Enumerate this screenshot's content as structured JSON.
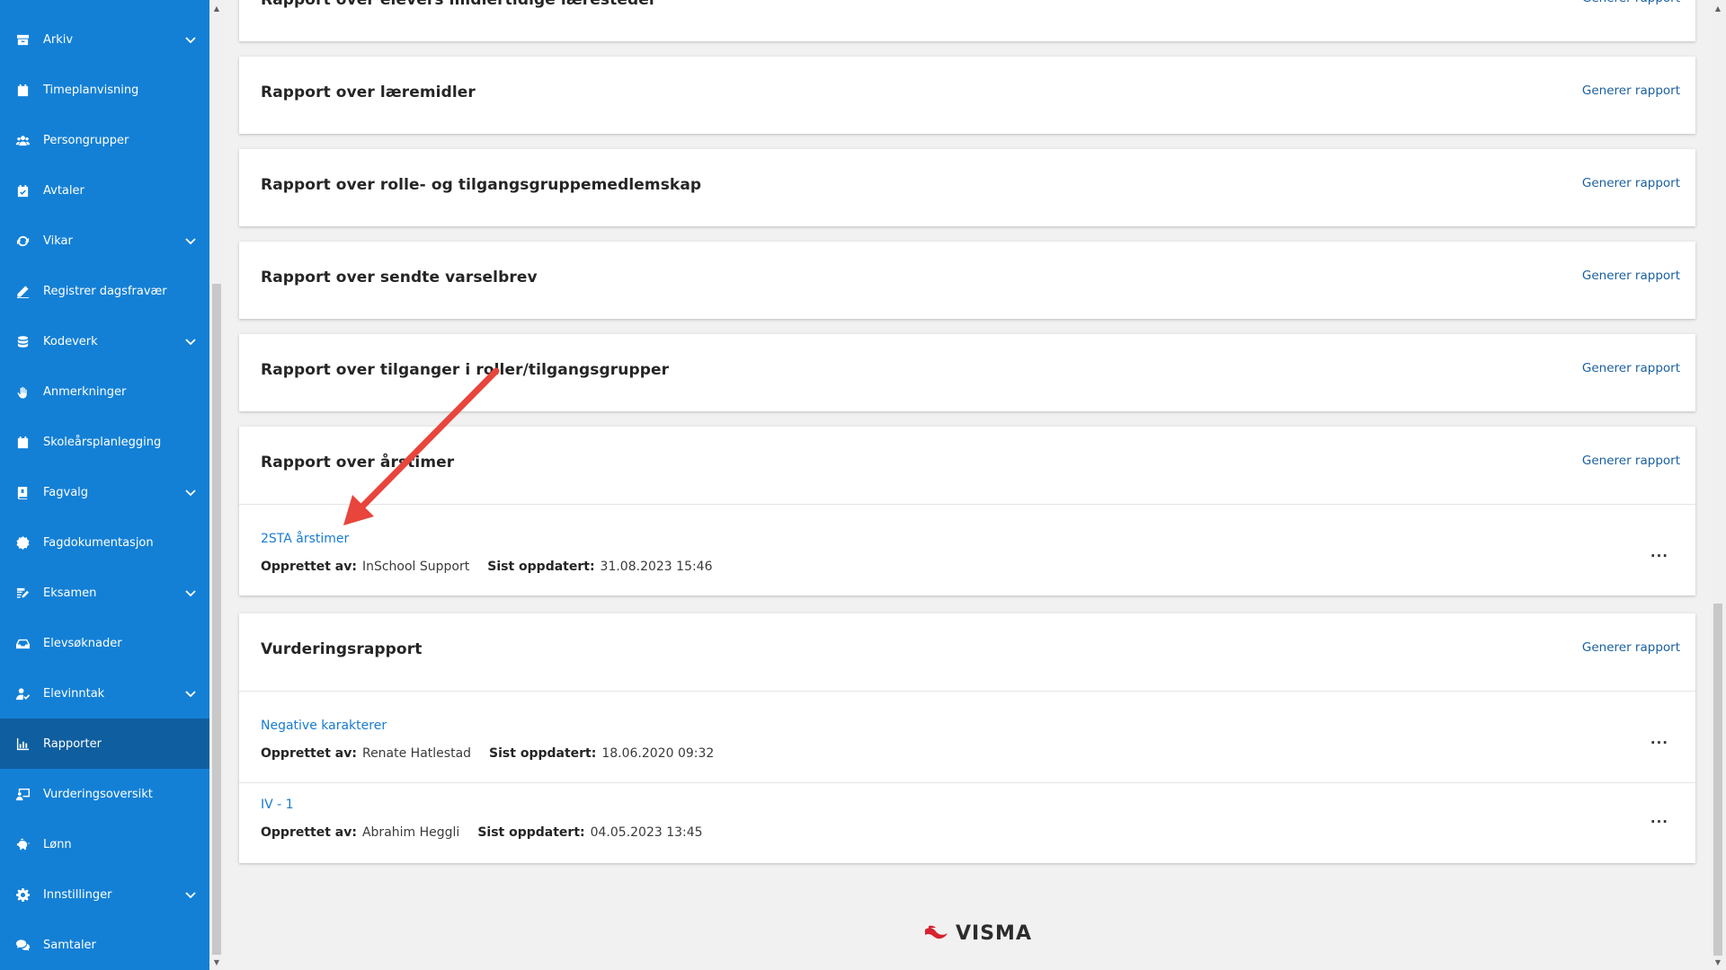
{
  "sidebar": {
    "items": [
      {
        "label": "Arkiv",
        "icon": "archive-icon",
        "chevron": true
      },
      {
        "label": "Timeplanvisning",
        "icon": "calendar-icon",
        "chevron": false
      },
      {
        "label": "Persongrupper",
        "icon": "users-icon",
        "chevron": false
      },
      {
        "label": "Avtaler",
        "icon": "calendar-check-icon",
        "chevron": false
      },
      {
        "label": "Vikar",
        "icon": "sync-icon",
        "chevron": true
      },
      {
        "label": "Registrer dagsfravær",
        "icon": "pencil-icon",
        "chevron": false
      },
      {
        "label": "Kodeverk",
        "icon": "database-icon",
        "chevron": true
      },
      {
        "label": "Anmerkninger",
        "icon": "hand-icon",
        "chevron": false
      },
      {
        "label": "Skoleårsplanlegging",
        "icon": "calendar-icon",
        "chevron": false
      },
      {
        "label": "Fagvalg",
        "icon": "book-icon",
        "chevron": true
      },
      {
        "label": "Fagdokumentasjon",
        "icon": "badge-icon",
        "chevron": false
      },
      {
        "label": "Eksamen",
        "icon": "edit-document-icon",
        "chevron": true
      },
      {
        "label": "Elevsøknader",
        "icon": "inbox-icon",
        "chevron": false
      },
      {
        "label": "Elevinntak",
        "icon": "user-check-icon",
        "chevron": true
      },
      {
        "label": "Rapporter",
        "icon": "bar-chart-icon",
        "chevron": false,
        "active": true
      },
      {
        "label": "Vurderingsoversikt",
        "icon": "presentation-icon",
        "chevron": false
      },
      {
        "label": "Lønn",
        "icon": "piggy-bank-icon",
        "chevron": false
      },
      {
        "label": "Innstillinger",
        "icon": "gear-icon",
        "chevron": true
      },
      {
        "label": "Samtaler",
        "icon": "chat-icon",
        "chevron": false
      }
    ]
  },
  "reports": {
    "action_label": "Generer rapport",
    "cards": [
      {
        "title": "Rapport over elevers midlertidige læresteder"
      },
      {
        "title": "Rapport over læremidler"
      },
      {
        "title": "Rapport over rolle- og tilgangsgruppemedlemskap"
      },
      {
        "title": "Rapport over sendte varselbrev"
      },
      {
        "title": "Rapport over tilganger i roller/tilgangsgrupper"
      },
      {
        "title": "Rapport over årstimer",
        "rows": [
          {
            "name": "2STA årstimer",
            "created_by_label": "Opprettet av:",
            "created_by": "InSchool Support",
            "updated_label": "Sist oppdatert:",
            "updated": "31.08.2023 15:46"
          }
        ]
      },
      {
        "title": "Vurderingsrapport",
        "rows": [
          {
            "name": "Negative karakterer",
            "created_by_label": "Opprettet av:",
            "created_by": "Renate Hatlestad",
            "updated_label": "Sist oppdatert:",
            "updated": "18.06.2020 09:32"
          },
          {
            "name": "IV - 1",
            "created_by_label": "Opprettet av:",
            "created_by": "Abrahim Heggli",
            "updated_label": "Sist oppdatert:",
            "updated": "04.05.2023 13:45"
          }
        ]
      }
    ]
  },
  "row_menu_glyph": "···",
  "footer": {
    "brand": "VISMA"
  },
  "colors": {
    "sidebar": "#1380d6",
    "sidebar_active": "#0f5e9f",
    "link": "#1a7bd1",
    "action": "#1a5f9e",
    "annotation_arrow": "#e8453c",
    "brand_red": "#d6232f"
  }
}
